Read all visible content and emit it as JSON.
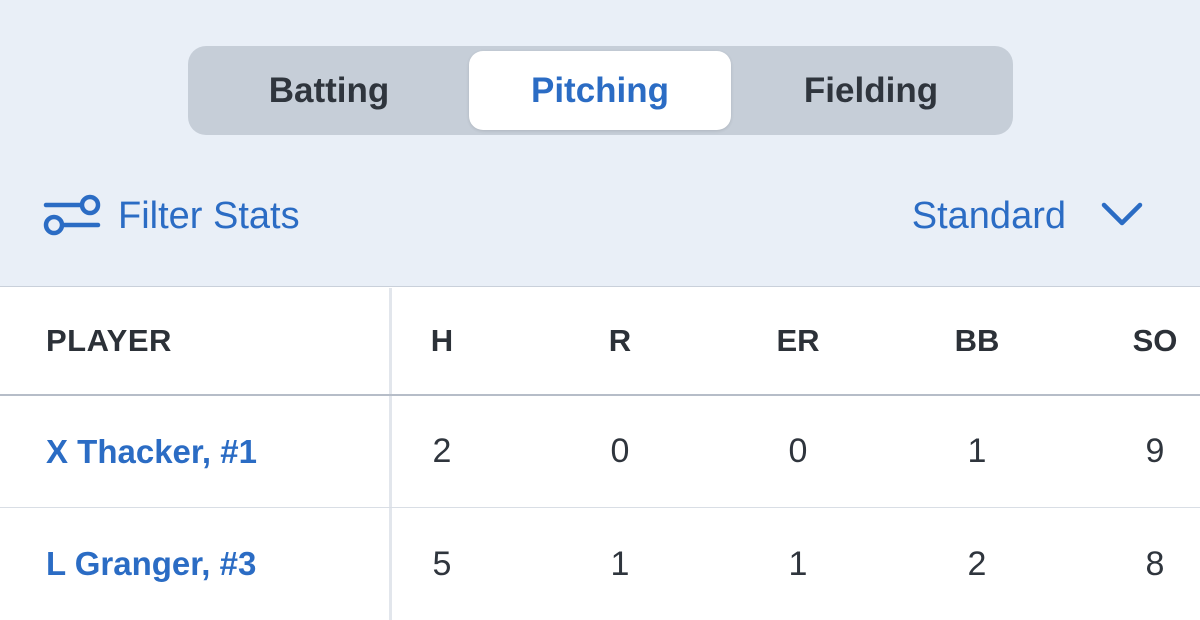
{
  "tabs": {
    "batting": "Batting",
    "pitching": "Pitching",
    "fielding": "Fielding",
    "selected": "Pitching"
  },
  "filter": {
    "label": "Filter Stats",
    "icon": "filter-sliders-icon"
  },
  "view_select": {
    "selected": "Standard",
    "icon": "chevron-down-icon"
  },
  "table": {
    "headers": [
      "PLAYER",
      "H",
      "R",
      "ER",
      "BB",
      "SO"
    ],
    "rows": [
      {
        "player": "X Thacker, #1",
        "stats": [
          "2",
          "0",
          "0",
          "1",
          "9"
        ]
      },
      {
        "player": "L Granger, #3",
        "stats": [
          "5",
          "1",
          "1",
          "2",
          "8"
        ]
      }
    ]
  },
  "colors": {
    "accent": "#2b6cc4",
    "header_bg": "#e9eff7",
    "segment_bg": "#c6ced8",
    "text_dark": "#2f353d"
  }
}
